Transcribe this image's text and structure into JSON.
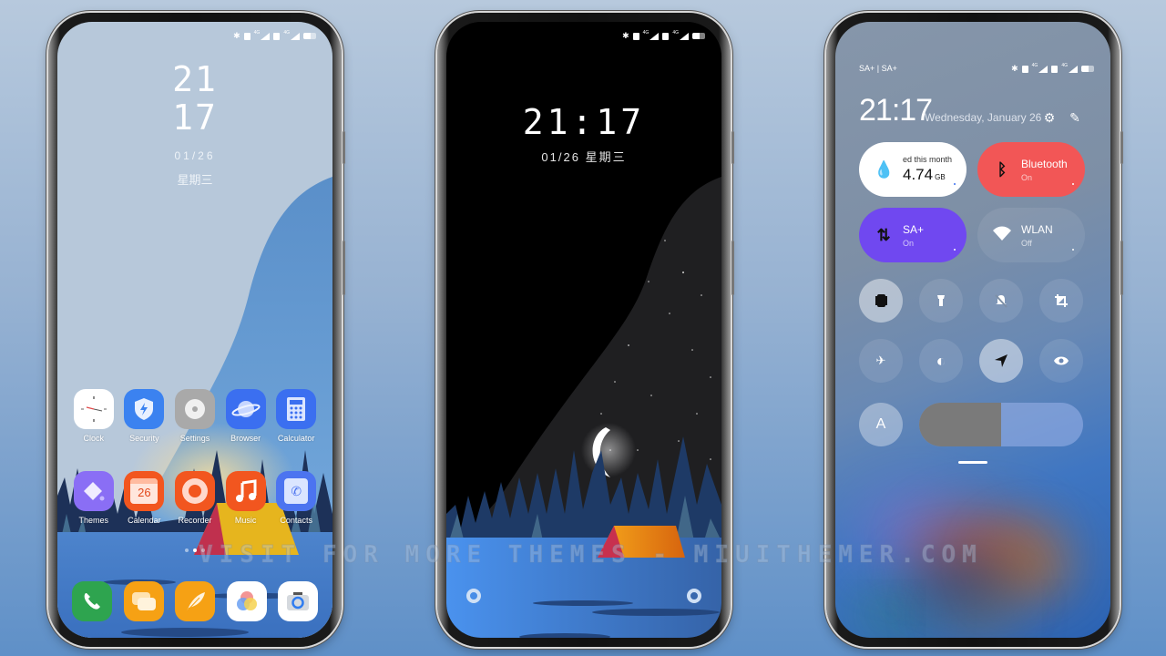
{
  "watermark": "VISIT FOR MORE THEMES - MIUITHEMER.COM",
  "status_bar": {
    "bluetooth": "✱",
    "network": "4G"
  },
  "home": {
    "clock_hour": "21",
    "clock_minute": "17",
    "date": "01/26",
    "weekday": "星期三",
    "apps_row1": [
      {
        "label": "Clock",
        "icon": "clock-icon"
      },
      {
        "label": "Security",
        "icon": "security-shield-icon"
      },
      {
        "label": "Settings",
        "icon": "settings-gear-icon"
      },
      {
        "label": "Browser",
        "icon": "browser-planet-icon"
      },
      {
        "label": "Calculator",
        "icon": "calculator-icon"
      }
    ],
    "apps_row2": [
      {
        "label": "Themes",
        "icon": "themes-icon"
      },
      {
        "label": "Calendar",
        "icon": "calendar-icon",
        "badge": "26"
      },
      {
        "label": "Recorder",
        "icon": "recorder-icon"
      },
      {
        "label": "Music",
        "icon": "music-note-icon"
      },
      {
        "label": "Contacts",
        "icon": "contacts-icon"
      }
    ],
    "dock": [
      {
        "name": "phone",
        "icon": "phone-icon"
      },
      {
        "name": "messages",
        "icon": "messages-icon"
      },
      {
        "name": "notes",
        "icon": "feather-icon"
      },
      {
        "name": "gallery",
        "icon": "gallery-icon"
      },
      {
        "name": "camera",
        "icon": "camera-icon"
      }
    ],
    "page_indicator": {
      "pages": 3,
      "current": 2
    }
  },
  "lock": {
    "time": "21:17",
    "date": "01/26",
    "weekday": "星期三"
  },
  "control_center": {
    "carrier": "SA+ | SA+",
    "time": "21:17",
    "date": "Wednesday, January 26",
    "tiles": [
      {
        "title": "4.74",
        "unit": "GB",
        "subtitle": "ed this month",
        "icon": "water-drop-icon",
        "color": "#ffffff"
      },
      {
        "title": "Bluetooth",
        "subtitle": "On",
        "icon": "bluetooth-icon",
        "color": "#f25656"
      },
      {
        "title": "SA+",
        "subtitle": "On",
        "icon": "mobile-data-icon",
        "color": "#7048f0"
      },
      {
        "title": "WLAN",
        "subtitle": "Off",
        "icon": "wifi-icon",
        "color": "#8090a8"
      }
    ],
    "toggles_row1": [
      {
        "name": "vibrate",
        "icon": "vibrate-icon",
        "glyph": "▮",
        "active": true
      },
      {
        "name": "flashlight",
        "icon": "flashlight-icon",
        "glyph": "🔦",
        "active": false
      },
      {
        "name": "mute",
        "icon": "bell-off-icon",
        "glyph": "🔕",
        "active": false
      },
      {
        "name": "screenshot",
        "icon": "crop-icon",
        "glyph": "⛶",
        "active": false
      }
    ],
    "toggles_row2": [
      {
        "name": "airplane",
        "icon": "airplane-icon",
        "glyph": "✈",
        "active": false
      },
      {
        "name": "dark-mode",
        "icon": "contrast-icon",
        "glyph": "◐",
        "active": false
      },
      {
        "name": "location",
        "icon": "location-arrow-icon",
        "glyph": "➤",
        "active": true
      },
      {
        "name": "reading-mode",
        "icon": "eye-icon",
        "glyph": "◉",
        "active": false
      }
    ],
    "auto_brightness": {
      "label": "A"
    },
    "brightness_level": 0.5
  }
}
